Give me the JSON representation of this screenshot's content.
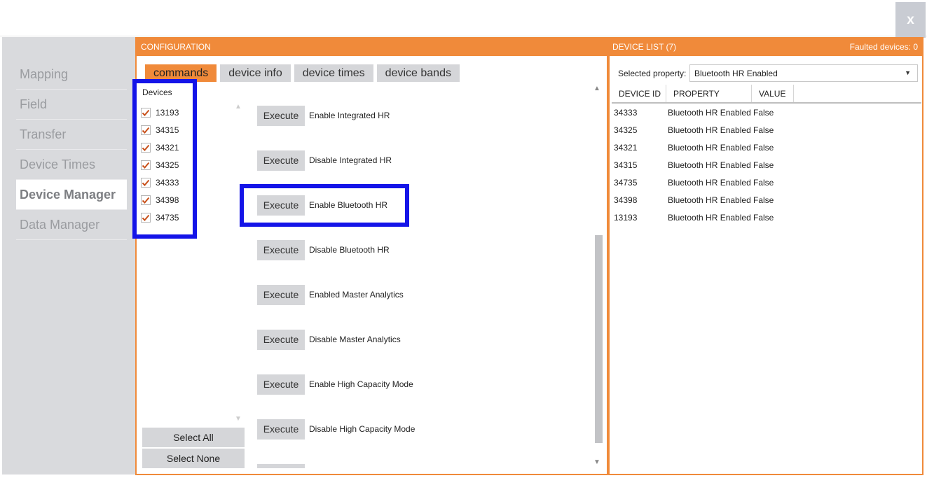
{
  "window": {
    "close_label": "x"
  },
  "nav": {
    "items": [
      {
        "label": "Mapping",
        "active": false
      },
      {
        "label": "Field",
        "active": false
      },
      {
        "label": "Transfer",
        "active": false
      },
      {
        "label": "Device Times",
        "active": false
      },
      {
        "label": "Device Manager",
        "active": true
      },
      {
        "label": "Data Manager",
        "active": false
      }
    ]
  },
  "config": {
    "title": "CONFIGURATION",
    "tabs": [
      {
        "label": "commands",
        "active": true
      },
      {
        "label": "device info",
        "active": false
      },
      {
        "label": "device times",
        "active": false
      },
      {
        "label": "device bands",
        "active": false
      }
    ],
    "devices_title": "Devices",
    "devices": [
      {
        "id": "13193",
        "checked": true
      },
      {
        "id": "34315",
        "checked": true
      },
      {
        "id": "34321",
        "checked": true
      },
      {
        "id": "34325",
        "checked": true
      },
      {
        "id": "34333",
        "checked": true
      },
      {
        "id": "34398",
        "checked": true
      },
      {
        "id": "34735",
        "checked": true
      }
    ],
    "select_all_label": "Select All",
    "select_none_label": "Select None",
    "execute_label": "Execute",
    "commands": [
      "Enable Integrated HR",
      "Disable Integrated HR",
      "Enable Bluetooth HR",
      "Disable Bluetooth HR",
      "Enabled Master Analytics",
      "Disable Master Analytics",
      "Enable High Capacity Mode",
      "Disable High Capacity Mode"
    ]
  },
  "device_list": {
    "title": "DEVICE LIST (7)",
    "faulted": "Faulted devices: 0",
    "property_label": "Selected property:",
    "property_value": "Bluetooth HR Enabled",
    "columns": [
      "DEVICE ID",
      "PROPERTY",
      "VALUE"
    ],
    "rows": [
      [
        "34333",
        "Bluetooth HR Enabled",
        "False"
      ],
      [
        "34325",
        "Bluetooth HR Enabled",
        "False"
      ],
      [
        "34321",
        "Bluetooth HR Enabled",
        "False"
      ],
      [
        "34315",
        "Bluetooth HR Enabled",
        "False"
      ],
      [
        "34735",
        "Bluetooth HR Enabled",
        "False"
      ],
      [
        "34398",
        "Bluetooth HR Enabled",
        "False"
      ],
      [
        "13193",
        "Bluetooth HR Enabled",
        "False"
      ]
    ]
  },
  "colors": {
    "accent": "#f08a3a",
    "highlight": "#1414e8",
    "checkmark": "#c8501a"
  }
}
